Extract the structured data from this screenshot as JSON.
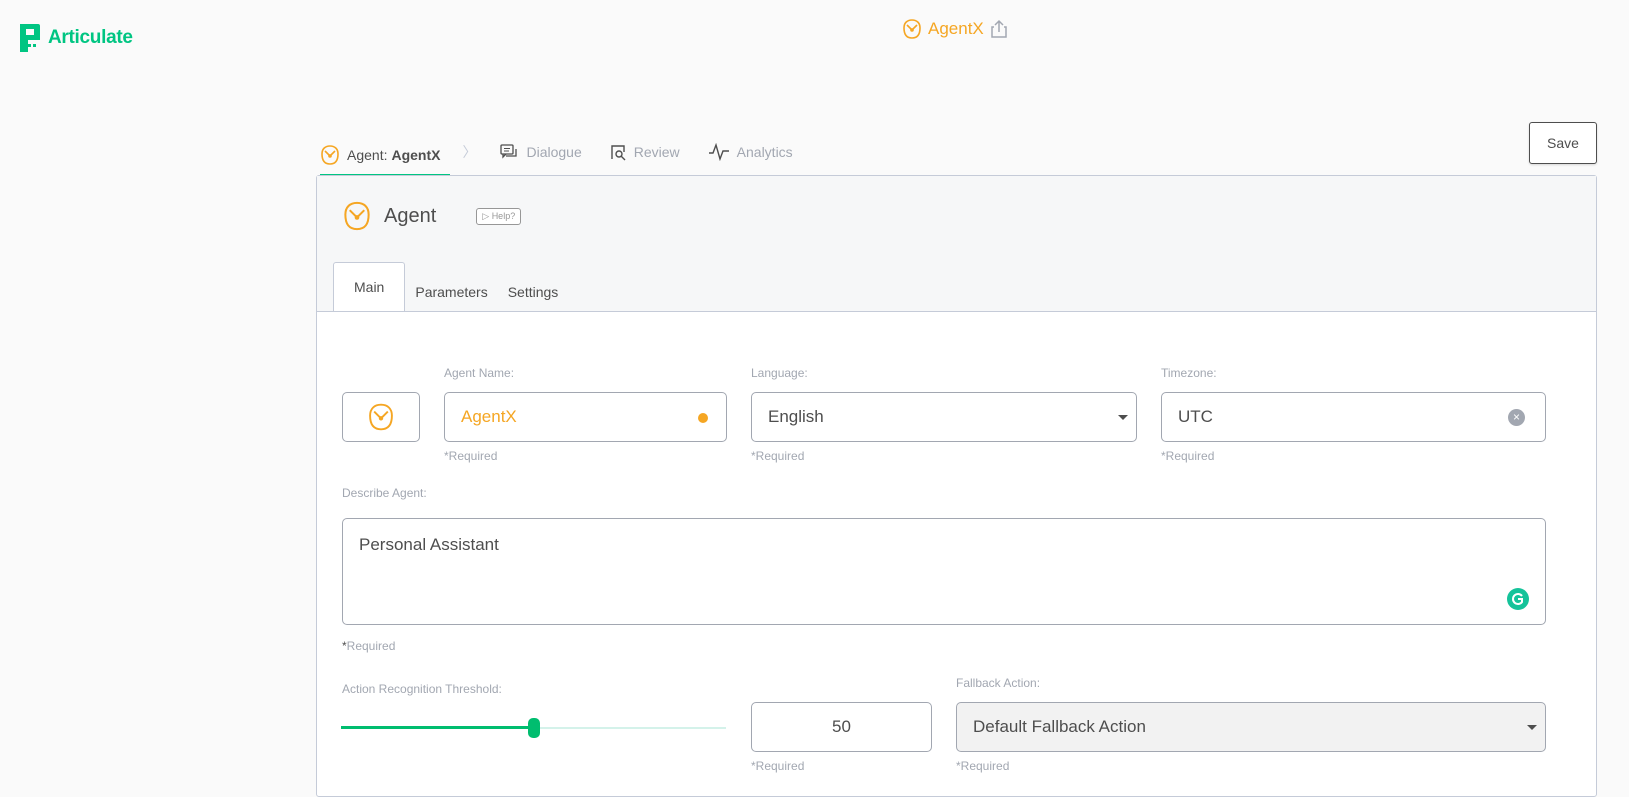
{
  "brand": {
    "name": "Articulate",
    "color": "#00c582",
    "icon": "articulate-logo-icon"
  },
  "header": {
    "agent_name": "AgentX",
    "agent_icon": "agent-owl-icon",
    "share_icon": "share-icon"
  },
  "nav": {
    "agent_prefix": "Agent: ",
    "agent_name": "AgentX",
    "separator": "〉",
    "items": [
      {
        "label": "Dialogue",
        "icon": "dialogue-icon"
      },
      {
        "label": "Review",
        "icon": "review-icon"
      },
      {
        "label": "Analytics",
        "icon": "analytics-icon"
      }
    ],
    "save_label": "Save"
  },
  "panel": {
    "title": "Agent",
    "help_label": "▷ Help?",
    "tabs": [
      "Main",
      "Parameters",
      "Settings"
    ],
    "active_tab": "Main"
  },
  "form": {
    "agent_name": {
      "label": "Agent Name:",
      "value": "AgentX",
      "required": "*Required"
    },
    "language": {
      "label": "Language:",
      "value": "English",
      "required": "*Required"
    },
    "timezone": {
      "label": "Timezone:",
      "value": "UTC",
      "required": "*Required",
      "clear": "×"
    },
    "description": {
      "label": "Describe Agent:",
      "value": "Personal Assistant",
      "required_star": "*",
      "required": "Required"
    },
    "threshold": {
      "label": "Action Recognition Threshold:",
      "value": "50",
      "slider_fraction": 0.5,
      "required": "*Required"
    },
    "fallback": {
      "label": "Fallback Action:",
      "value": "Default Fallback Action",
      "required": "*Required"
    }
  },
  "colors": {
    "accent": "#00c582",
    "agent": "#f5a623",
    "border": "#a2a7b1"
  }
}
